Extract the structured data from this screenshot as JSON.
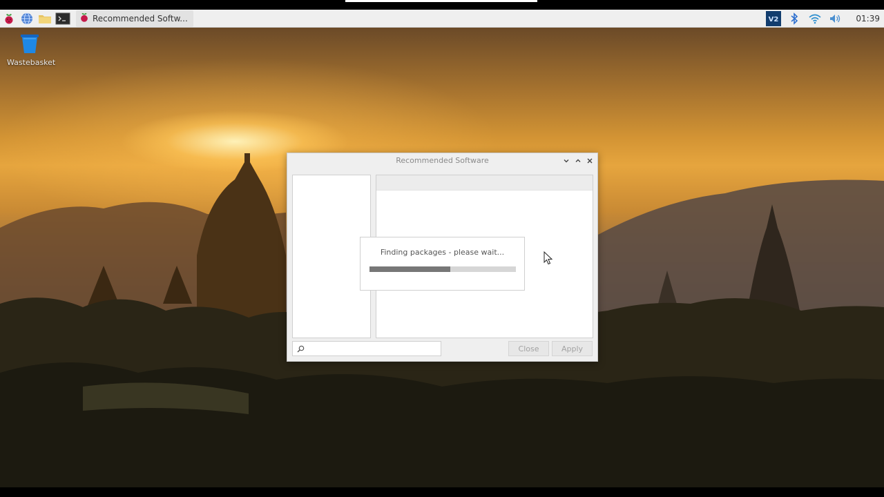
{
  "taskbar": {
    "task_label": "Recommended Softw...",
    "clock": "01:39",
    "tray_badge": "V2"
  },
  "desktop": {
    "trash_label": "Wastebasket"
  },
  "window": {
    "title": "Recommended Software",
    "search_placeholder": "",
    "close_label": "Close",
    "apply_label": "Apply"
  },
  "progress": {
    "message": "Finding packages - please wait...",
    "fraction": 0.55
  },
  "colors": {
    "taskbar_bg": "#efefef",
    "window_bg": "#efefef",
    "progress_fill": "#777777",
    "raspberry_red": "#c51a4a",
    "trash_blue": "#1e88e5"
  }
}
